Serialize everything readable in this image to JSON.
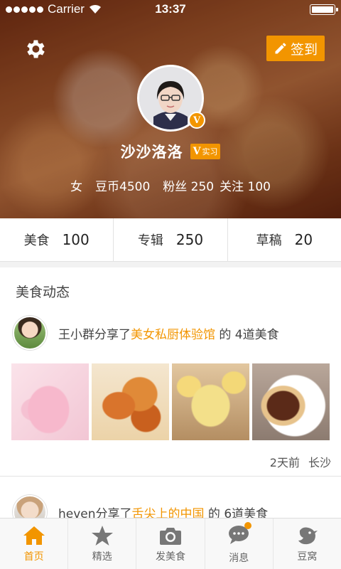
{
  "status_bar": {
    "carrier": "Carrier",
    "time": "13:37"
  },
  "header": {
    "signin_label": "签到",
    "username": "沙沙洛洛",
    "badge_v": "V",
    "badge_text": "实习",
    "avatar_badge": "V",
    "gender": "女",
    "coins": "豆币4500",
    "fans": "粉丝 250",
    "follows": "关注 100"
  },
  "counts": [
    {
      "label": "美食",
      "value": "100"
    },
    {
      "label": "专辑",
      "value": "250"
    },
    {
      "label": "草稿",
      "value": "20"
    }
  ],
  "feed": {
    "title": "美食动态",
    "posts": [
      {
        "user": "王小群分享了",
        "link": "美女私厨体验馆",
        "suffix": " 的 4道美食",
        "time": "2天前",
        "location": "长沙"
      },
      {
        "user": "heven分享了",
        "link": "舌尖上的中国",
        "suffix": " 的 6道美食"
      }
    ]
  },
  "tabbar": {
    "items": [
      {
        "label": "首页",
        "icon": "home-icon"
      },
      {
        "label": "精选",
        "icon": "star-icon"
      },
      {
        "label": "发美食",
        "icon": "camera-icon"
      },
      {
        "label": "消息",
        "icon": "chat-bubble-icon"
      },
      {
        "label": "豆窝",
        "icon": "bird-icon"
      }
    ],
    "active_color": "#f29500"
  },
  "colors": {
    "accent": "#f29500"
  }
}
